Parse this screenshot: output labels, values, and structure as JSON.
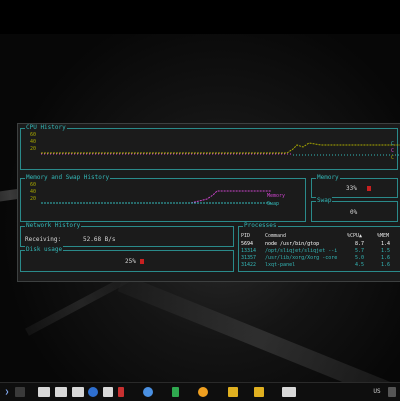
{
  "app": {
    "cpu_title": "CPU History",
    "cpu_ticks": [
      "60",
      "40",
      "20"
    ],
    "mem_title": "Memory and Swap History",
    "mem_ticks": [
      "60",
      "40",
      "20"
    ],
    "mem_legend": [
      "Memory",
      "Swap"
    ],
    "memory_title": "Memory",
    "memory_value": "33%",
    "swap_title": "Swap",
    "swap_value": "0%",
    "net_title": "Network History",
    "receiving_label": "Receiving:",
    "receiving_value": "52.68 B/s",
    "disk_title": "Disk usage",
    "disk_value": "25%",
    "proc_title": "Processes",
    "proc_columns": [
      "PID",
      "Command",
      "%CPU▲",
      "%MEM"
    ],
    "processes": [
      {
        "pid": "5694",
        "command": "node /usr/bin/gtop",
        "cpu": "8.7",
        "mem": "1.4"
      },
      {
        "pid": "13314",
        "command": "/opt/sliqjet/sliqjet --i",
        "cpu": "5.7",
        "mem": "1.5"
      },
      {
        "pid": "31357",
        "command": "/usr/lib/xorg/Xorg -core",
        "cpu": "5.0",
        "mem": "1.6"
      },
      {
        "pid": "31422",
        "command": "lxqt-panel",
        "cpu": "4.5",
        "mem": "1.6"
      }
    ]
  },
  "colors": {
    "border": "#2a8a8a",
    "title": "#33b8b8",
    "tick": "#a8a800",
    "memory_line": "#cc44cc",
    "swap_line": "#33b8b8",
    "selected_row": "#2f6fbf"
  },
  "taskbar": {
    "menu_icon": "arrow-icon",
    "tray_label": "US"
  }
}
